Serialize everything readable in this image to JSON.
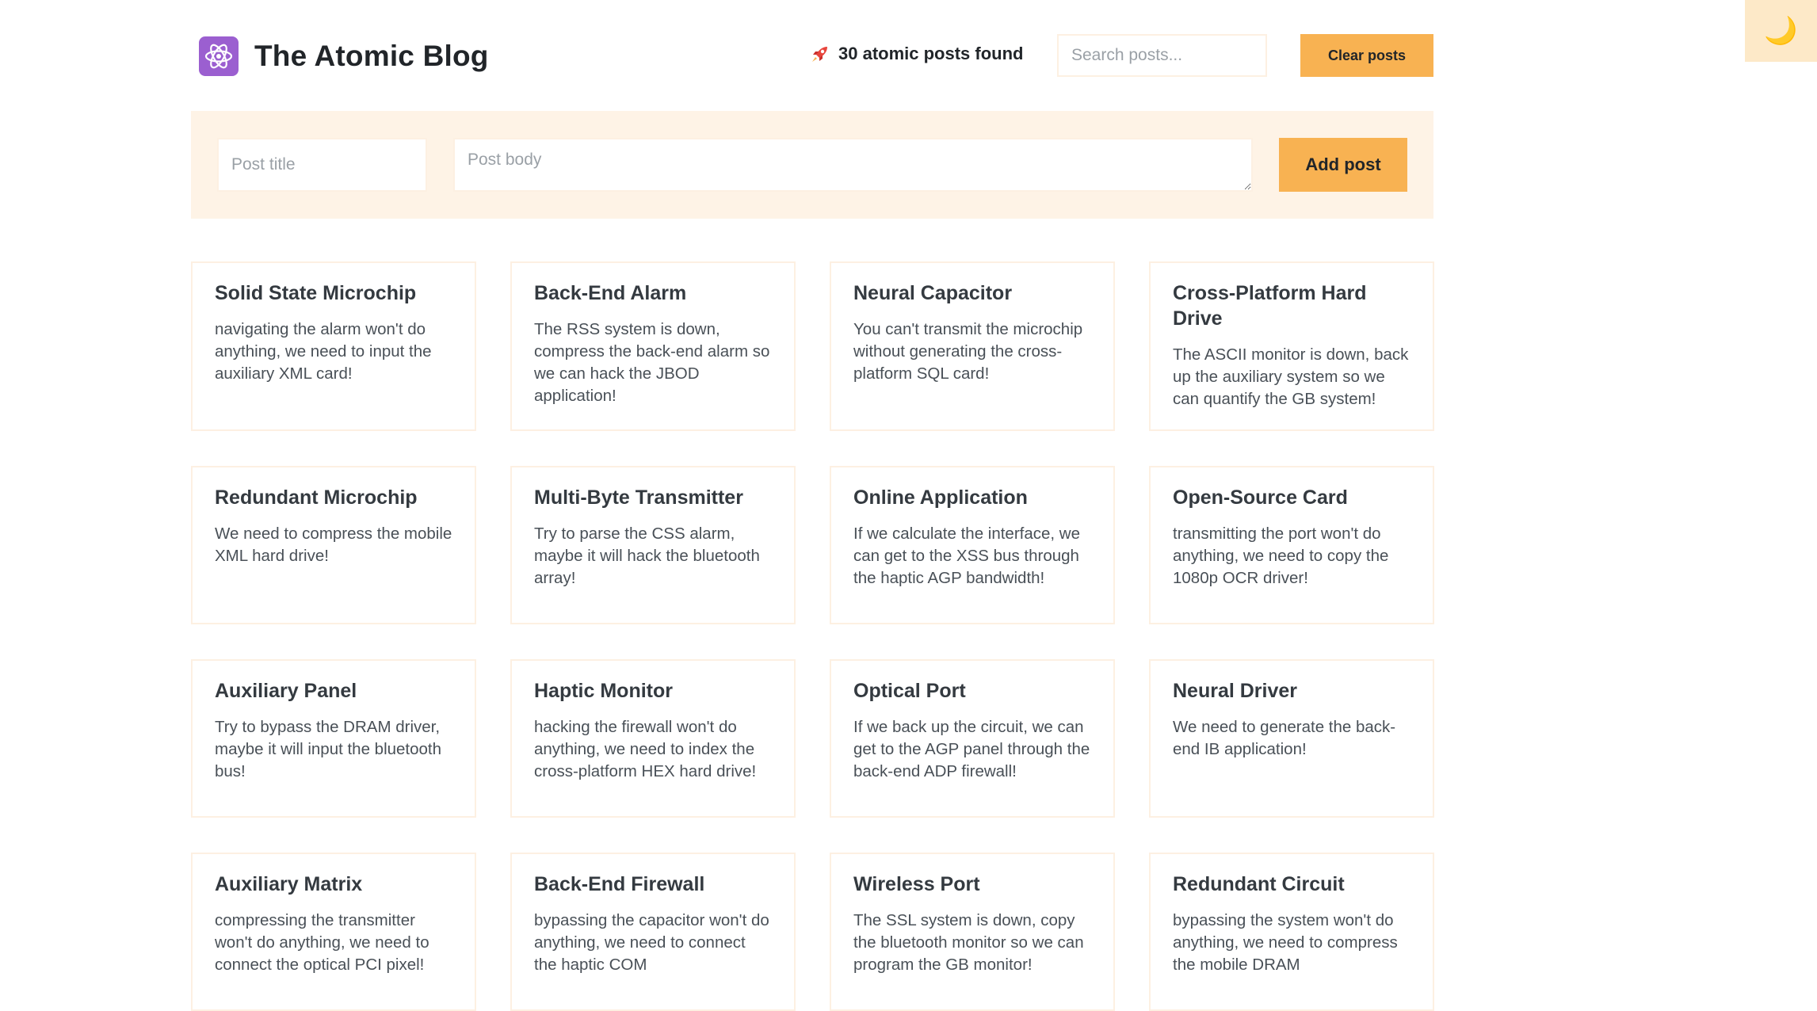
{
  "header": {
    "title": "The Atomic Blog",
    "posts_found": "30 atomic posts found",
    "search_placeholder": "Search posts...",
    "clear_label": "Clear posts"
  },
  "form": {
    "title_placeholder": "Post title",
    "body_placeholder": "Post body",
    "add_label": "Add post"
  },
  "theme": {
    "toggle_icon": "🌙",
    "accent": "#f8b252",
    "panel_bg": "#fef3e6",
    "logo_bg": "#9b5fd0"
  },
  "posts": [
    {
      "title": "Solid State Microchip",
      "body": "navigating the alarm won't do anything, we need to input the auxiliary XML card!"
    },
    {
      "title": "Back-End Alarm",
      "body": "The RSS system is down, compress the back-end alarm so we can hack the JBOD application!"
    },
    {
      "title": "Neural Capacitor",
      "body": "You can't transmit the microchip without generating the cross-platform SQL card!"
    },
    {
      "title": "Cross-Platform Hard Drive",
      "body": "The ASCII monitor is down, back up the auxiliary system so we can quantify the GB system!"
    },
    {
      "title": "Redundant Microchip",
      "body": "We need to compress the mobile XML hard drive!"
    },
    {
      "title": "Multi-Byte Transmitter",
      "body": "Try to parse the CSS alarm, maybe it will hack the bluetooth array!"
    },
    {
      "title": "Online Application",
      "body": "If we calculate the interface, we can get to the XSS bus through the haptic AGP bandwidth!"
    },
    {
      "title": "Open-Source Card",
      "body": "transmitting the port won't do anything, we need to copy the 1080p OCR driver!"
    },
    {
      "title": "Auxiliary Panel",
      "body": "Try to bypass the DRAM driver, maybe it will input the bluetooth bus!"
    },
    {
      "title": "Haptic Monitor",
      "body": "hacking the firewall won't do anything, we need to index the cross-platform HEX hard drive!"
    },
    {
      "title": "Optical Port",
      "body": "If we back up the circuit, we can get to the AGP panel through the back-end ADP firewall!"
    },
    {
      "title": "Neural Driver",
      "body": "We need to generate the back-end IB application!"
    },
    {
      "title": "Auxiliary Matrix",
      "body": "compressing the transmitter won't do anything, we need to connect the optical PCI pixel!"
    },
    {
      "title": "Back-End Firewall",
      "body": "bypassing the capacitor won't do anything, we need to connect the haptic COM"
    },
    {
      "title": "Wireless Port",
      "body": "The SSL system is down, copy the bluetooth monitor so we can program the GB monitor!"
    },
    {
      "title": "Redundant Circuit",
      "body": "bypassing the system won't do anything, we need to compress the mobile DRAM"
    }
  ]
}
